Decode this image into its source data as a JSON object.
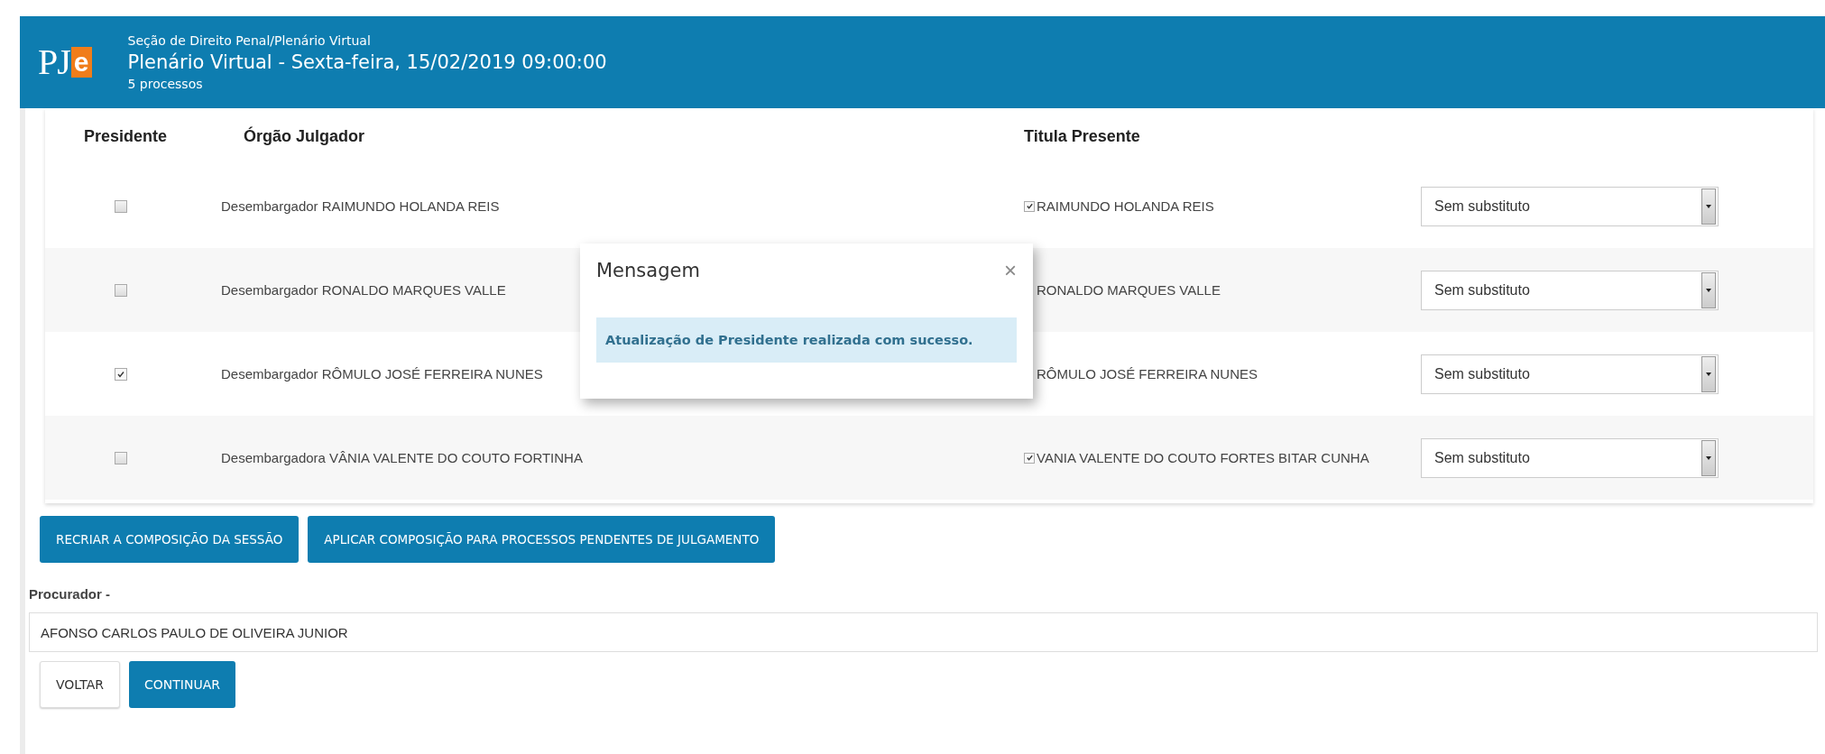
{
  "header": {
    "logo": {
      "letters": "PJ",
      "accent": "e"
    },
    "section": "Seção de Direito Penal/Plenário Virtual",
    "title": "Plenário Virtual - Sexta-feira, 15/02/2019 09:00:00",
    "subtitle": "5 processos"
  },
  "table": {
    "columns": [
      "Presidente",
      "Órgão Julgador",
      "Titula Presente"
    ],
    "rows": [
      {
        "president_checked": false,
        "orgao": "Desembargador RAIMUNDO HOLANDA REIS",
        "titular": {
          "checked": true,
          "name": "RAIMUNDO HOLANDA REIS"
        },
        "substitute": "Sem substituto"
      },
      {
        "president_checked": false,
        "orgao": "Desembargador RONALDO MARQUES VALLE",
        "titular": {
          "name": "RONALDO MARQUES VALLE"
        },
        "substitute": "Sem substituto"
      },
      {
        "president_checked": true,
        "orgao": "Desembargador RÔMULO JOSÉ FERREIRA NUNES",
        "titular": {
          "name": "RÔMULO JOSÉ FERREIRA NUNES"
        },
        "substitute": "Sem substituto"
      },
      {
        "president_checked": false,
        "orgao": "Desembargadora VÂNIA VALENTE DO COUTO FORTINHA",
        "titular": {
          "checked": true,
          "name": "VANIA VALENTE DO COUTO FORTES BITAR CUNHA"
        },
        "substitute": "Sem substituto"
      }
    ]
  },
  "modal": {
    "title": "Mensagem",
    "close": "×",
    "message": "Atualização de Presidente realizada com sucesso."
  },
  "actions": [
    "RECRIAR A COMPOSIÇÃO DA SESSÃO",
    "APLICAR COMPOSIÇÃO PARA PROCESSOS PENDENTES DE JULGAMENTO"
  ],
  "procurador": {
    "label": "Procurador -",
    "value": "AFONSO CARLOS PAULO DE OLIVEIRA JUNIOR"
  },
  "footer_buttons": [
    {
      "label": "VOLTAR",
      "kind": "default"
    },
    {
      "label": "CONTINUAR",
      "kind": "primary"
    }
  ]
}
